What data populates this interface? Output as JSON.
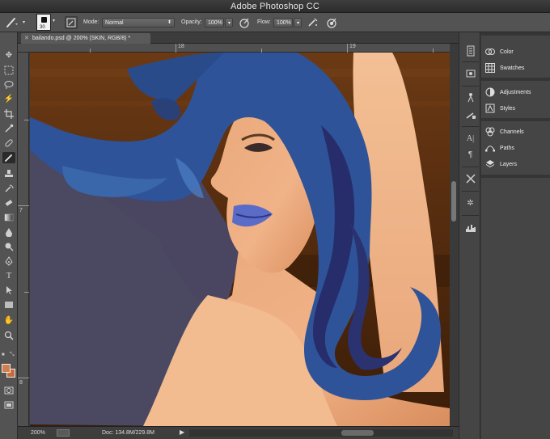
{
  "window": {
    "title": "Adobe Photoshop CC"
  },
  "options_bar": {
    "brush_size": "30",
    "mode_label": "Mode:",
    "mode_value": "Normal",
    "opacity_label": "Opacity:",
    "opacity_value": "100%",
    "flow_label": "Flow:",
    "flow_value": "100%"
  },
  "document": {
    "tab_title": "bailando.psd @ 200% (SKIN, RGB/8) *",
    "ruler_h": [
      "18",
      "19"
    ],
    "ruler_v": [
      "7",
      "8"
    ]
  },
  "status_bar": {
    "zoom": "200%",
    "doc_info": "Doc: 134.8M/229.8M"
  },
  "panels": [
    {
      "label": "Color",
      "icon": "color-wheel-icon"
    },
    {
      "label": "Swatches",
      "icon": "swatches-grid-icon"
    },
    {
      "label": "Adjustments",
      "icon": "adjustments-icon"
    },
    {
      "label": "Styles",
      "icon": "styles-icon"
    },
    {
      "label": "Channels",
      "icon": "channels-icon"
    },
    {
      "label": "Paths",
      "icon": "paths-icon"
    },
    {
      "label": "Layers",
      "icon": "layers-icon"
    }
  ],
  "colors": {
    "foreground": "#d07e4c",
    "background": "#c86b3a",
    "hair": "#2e4f8f",
    "skin": "#e7a275"
  }
}
